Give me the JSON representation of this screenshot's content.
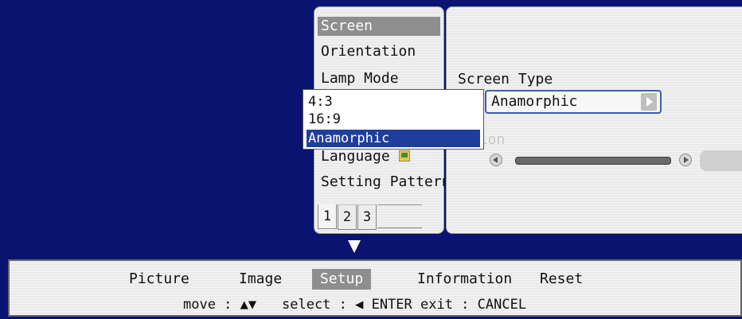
{
  "menu": {
    "items": [
      {
        "label": "Screen",
        "selected": true
      },
      {
        "label": "Orientation"
      },
      {
        "label": "Lamp Mode"
      },
      {
        "label": "Language"
      },
      {
        "label": "Setting Pattern"
      }
    ],
    "pages": [
      "1",
      "2",
      "3"
    ],
    "active_page": "1"
  },
  "detail": {
    "screen_type_label": "Screen Type",
    "screen_type_value": "Anamorphic",
    "position_label": "tion"
  },
  "dropdown": {
    "options": [
      "4:3",
      "16:9",
      "Anamorphic"
    ],
    "selected": "Anamorphic"
  },
  "main_tabs": [
    {
      "label": "Picture"
    },
    {
      "label": "Image"
    },
    {
      "label": "Setup",
      "selected": true
    },
    {
      "label": "Information"
    },
    {
      "label": "Reset"
    }
  ],
  "hints": {
    "move": "move : ▲▼",
    "select": "select : ◀ ENTER",
    "exit": "exit : CANCEL"
  },
  "colors": {
    "background": "#0a1470",
    "highlight": "#1f3d9c",
    "selected_gray": "#8e8e8e"
  }
}
